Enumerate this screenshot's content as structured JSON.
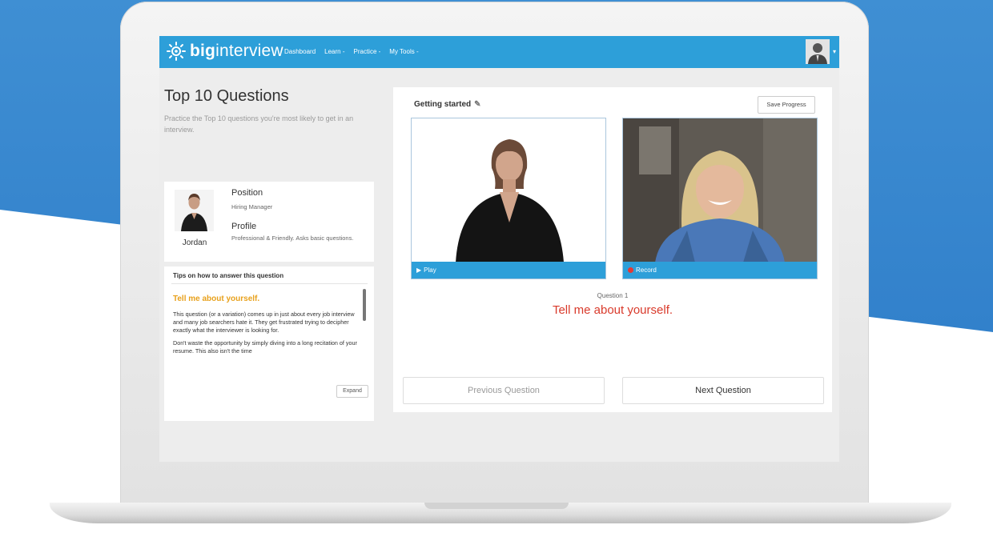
{
  "nav": {
    "logo_bold": "big",
    "logo_light": "interview",
    "items": [
      "Dashboard",
      "Learn -",
      "Practice -",
      "My Tools -"
    ],
    "avatar_caret": "▾"
  },
  "left": {
    "title": "Top 10 Questions",
    "description": "Practice the Top 10 questions you're most likely to get in an interview.",
    "interviewer": {
      "name": "Jordan",
      "position_label": "Position",
      "position_value": "Hiring Manager",
      "profile_label": "Profile",
      "profile_value": "Professional & Friendly. Asks basic questions."
    },
    "tips": {
      "title": "Tips on how to answer this question",
      "question": "Tell me about yourself.",
      "paragraph_1": "This question (or a variation) comes up in just about every job interview and many job searchers hate it. They get frustrated trying to decipher exactly what the interviewer is looking for.",
      "paragraph_2": "Don't waste the opportunity by simply diving into a long recitation of your resume. This also isn't the time",
      "expand_label": "Expand"
    }
  },
  "right": {
    "section_title": "Getting started",
    "save_label": "Save Progress",
    "play_label": "Play",
    "record_label": "Record",
    "question_number": "Question 1",
    "question_text": "Tell me about yourself.",
    "prev_label": "Previous Question",
    "next_label": "Next Question"
  },
  "colors": {
    "brand_blue": "#2d9fd9",
    "question_red": "#d93a2b",
    "tip_orange": "#e8a11c",
    "record_red": "#e53935"
  },
  "icons": [
    "sun-logo-icon",
    "user-avatar-icon",
    "pencil-icon",
    "play-icon",
    "record-dot-icon"
  ]
}
